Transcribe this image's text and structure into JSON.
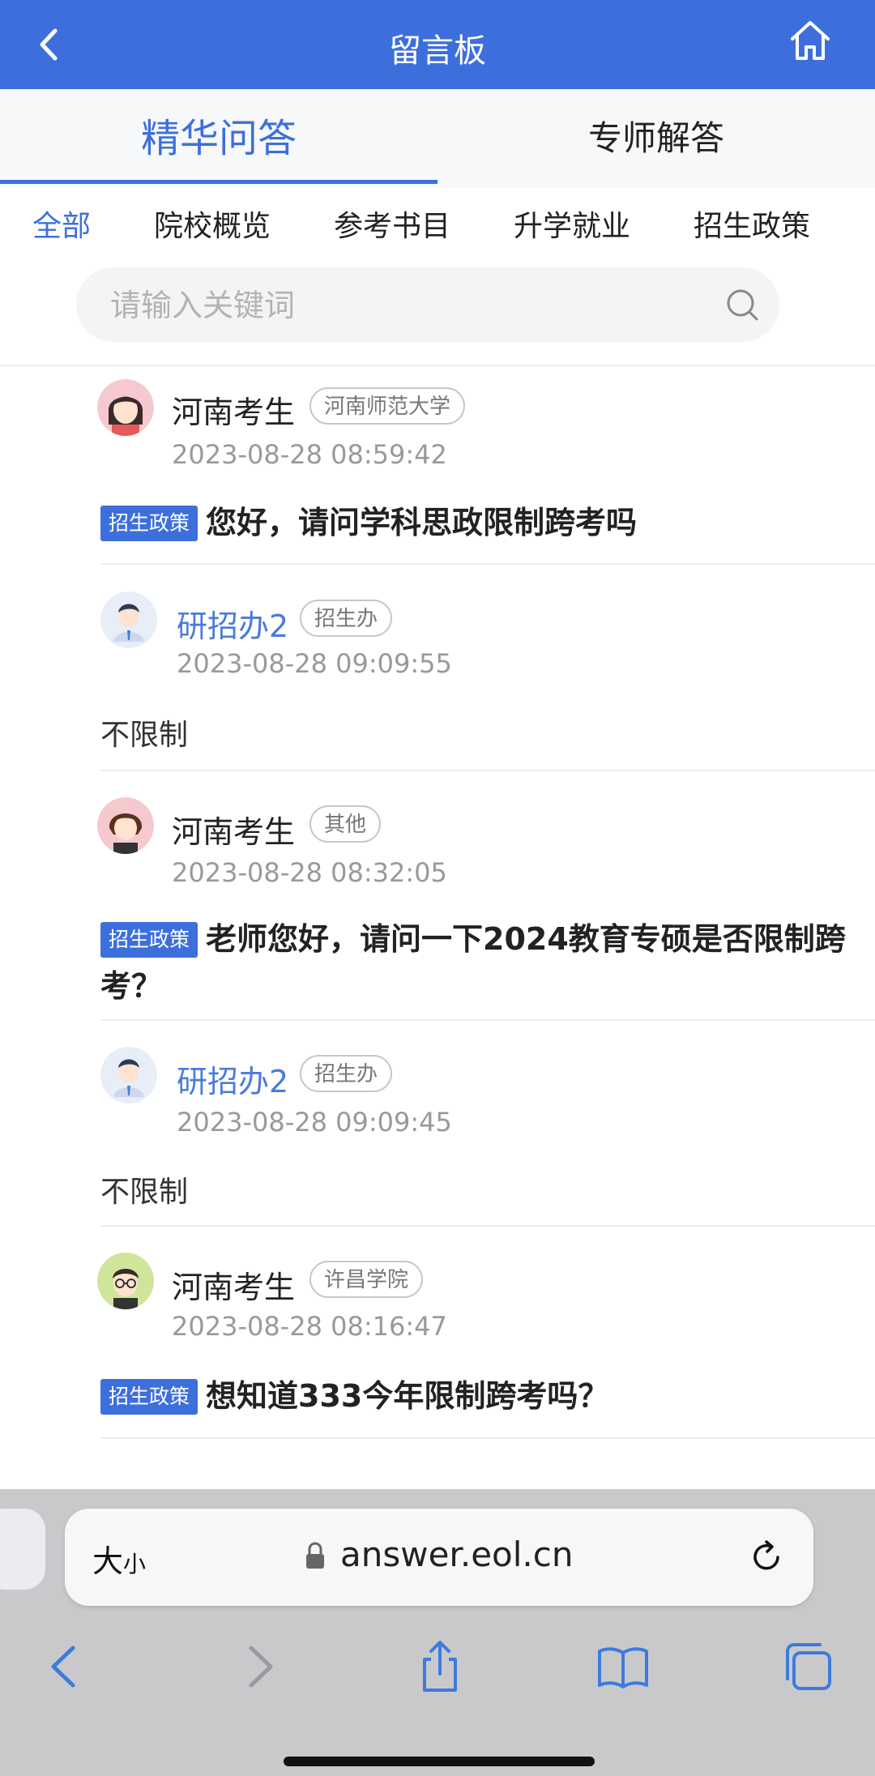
{
  "header": {
    "title": "留言板"
  },
  "tabs": [
    {
      "label": "精华问答"
    },
    {
      "label": "专师解答"
    }
  ],
  "categories": [
    "全部",
    "院校概览",
    "参考书目",
    "升学就业",
    "招生政策"
  ],
  "search": {
    "placeholder": "请输入关键词"
  },
  "posts": [
    {
      "question": {
        "name": "河南考生",
        "school": "河南师范大学",
        "time": "2023-08-28 08:59:42",
        "tag": "招生政策",
        "text": "您好，请问学科思政限制跨考吗"
      },
      "answer": {
        "name": "研招办2",
        "role": "招生办",
        "time": "2023-08-28 09:09:55",
        "text": "不限制"
      }
    },
    {
      "question": {
        "name": "河南考生",
        "school": "其他",
        "time": "2023-08-28 08:32:05",
        "tag": "招生政策",
        "text": "老师您好，请问一下2024教育专硕是否限制跨考？"
      },
      "answer": {
        "name": "研招办2",
        "role": "招生办",
        "time": "2023-08-28 09:09:45",
        "text": "不限制"
      }
    },
    {
      "question": {
        "name": "河南考生",
        "school": "许昌学院",
        "time": "2023-08-28 08:16:47",
        "tag": "招生政策",
        "text": "想知道333今年限制跨考吗？"
      }
    }
  ],
  "browser": {
    "size_label": "大",
    "size_label_small": "小",
    "url": "answer.eol.cn"
  },
  "colors": {
    "accent": "#3d6fdc",
    "tag_bg": "#3d6fdc",
    "staff_name": "#4b7bd8"
  }
}
